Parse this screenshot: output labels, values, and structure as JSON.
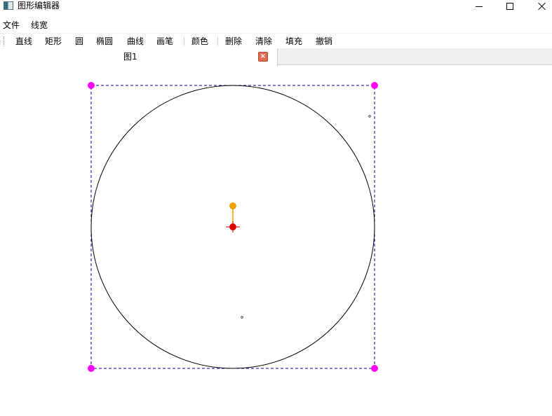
{
  "window": {
    "title": "图形编辑器",
    "icon": "app-icon"
  },
  "menu": {
    "items": [
      "文件",
      "线宽"
    ]
  },
  "toolbar": {
    "items": [
      "直线",
      "矩形",
      "圆",
      "椭圆",
      "曲线",
      "画笔",
      "颜色",
      "删除",
      "清除",
      "填充",
      "撤销"
    ]
  },
  "tabs": [
    {
      "label": "图1",
      "active": true
    }
  ],
  "canvas": {
    "selected_shape": "circle",
    "colors": {
      "outline": "#000000",
      "selection_box": "#0000aa",
      "handle": "#ff00ff",
      "rotate_handle": "#f0a000",
      "center": "#e00000"
    }
  }
}
